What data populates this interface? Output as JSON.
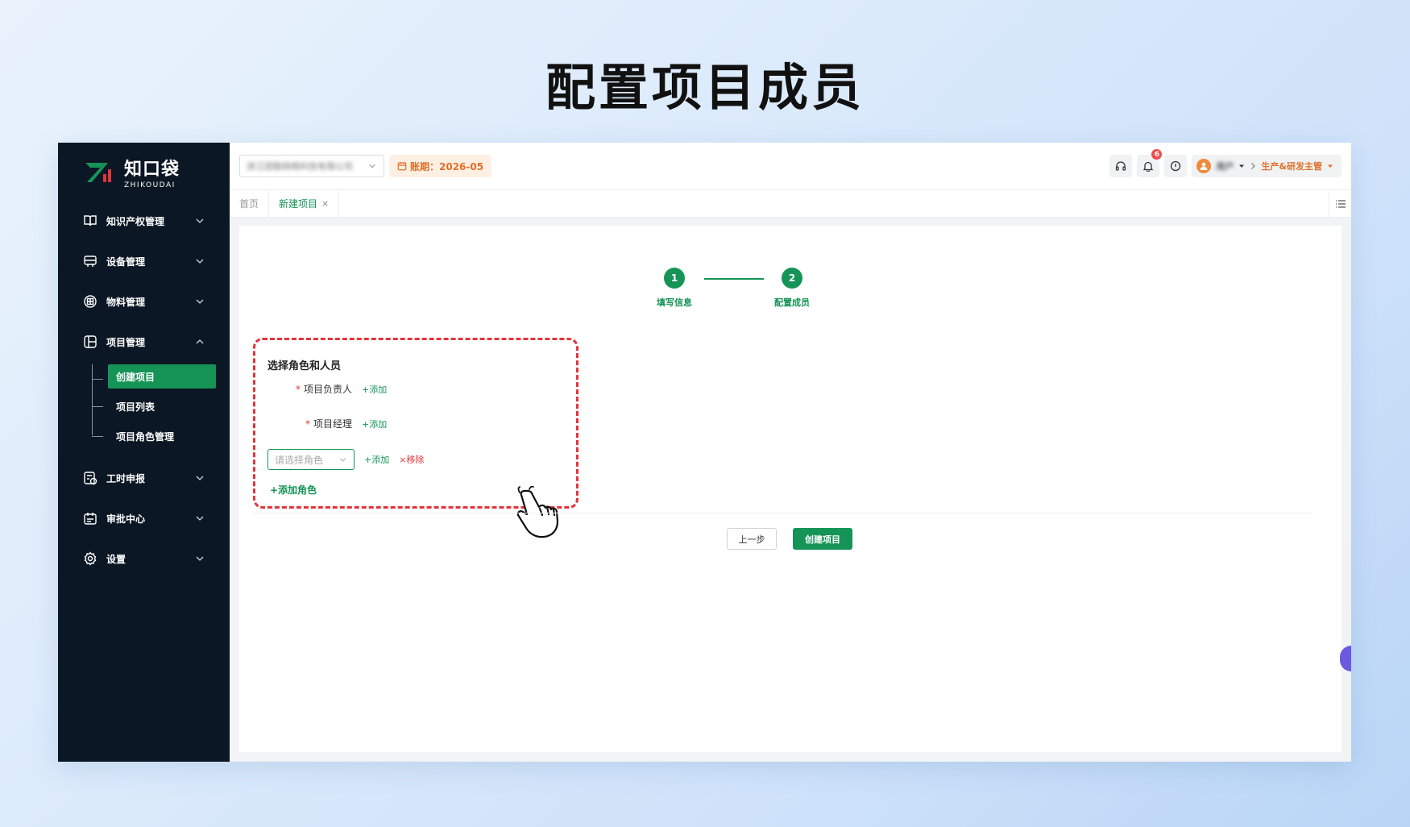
{
  "hero": {
    "title": "配置项目成员"
  },
  "logo": {
    "name": "知口袋",
    "sub": "ZHIKOUDAI"
  },
  "sidebar": {
    "items": [
      {
        "label": "知识产权管理",
        "icon": "book-icon"
      },
      {
        "label": "设备管理",
        "icon": "device-icon"
      },
      {
        "label": "物料管理",
        "icon": "material-icon"
      },
      {
        "label": "项目管理",
        "icon": "project-icon"
      },
      {
        "label": "工时申报",
        "icon": "timesheet-icon"
      },
      {
        "label": "审批中心",
        "icon": "approval-icon"
      },
      {
        "label": "设置",
        "icon": "gear-icon"
      }
    ],
    "project_sub": [
      {
        "label": "创建项目"
      },
      {
        "label": "项目列表"
      },
      {
        "label": "项目角色管理"
      }
    ]
  },
  "topbar": {
    "company": "浙江团联网络科技有限公司",
    "period": "账期：2026-05",
    "notification_count": "6",
    "user_name": "用户",
    "role": "生产&研发主管"
  },
  "tabs": [
    {
      "label": "首页"
    },
    {
      "label": "新建项目",
      "close": "×"
    }
  ],
  "steps": [
    {
      "num": "1",
      "label": "填写信息"
    },
    {
      "num": "2",
      "label": "配置成员"
    }
  ],
  "form": {
    "title": "选择角色和人员",
    "required_mark": "*",
    "leader_label": "项目负责人",
    "manager_label": "项目经理",
    "add_label": "+添加",
    "role_placeholder": "请选择角色",
    "remove_label": "×移除",
    "add_role_label": "+添加角色"
  },
  "buttons": {
    "prev": "上一步",
    "create": "创建项目"
  },
  "colors": {
    "primary": "#169457",
    "sidebar": "#0b1724",
    "accent": "#e0702a",
    "danger": "#e2343b"
  }
}
